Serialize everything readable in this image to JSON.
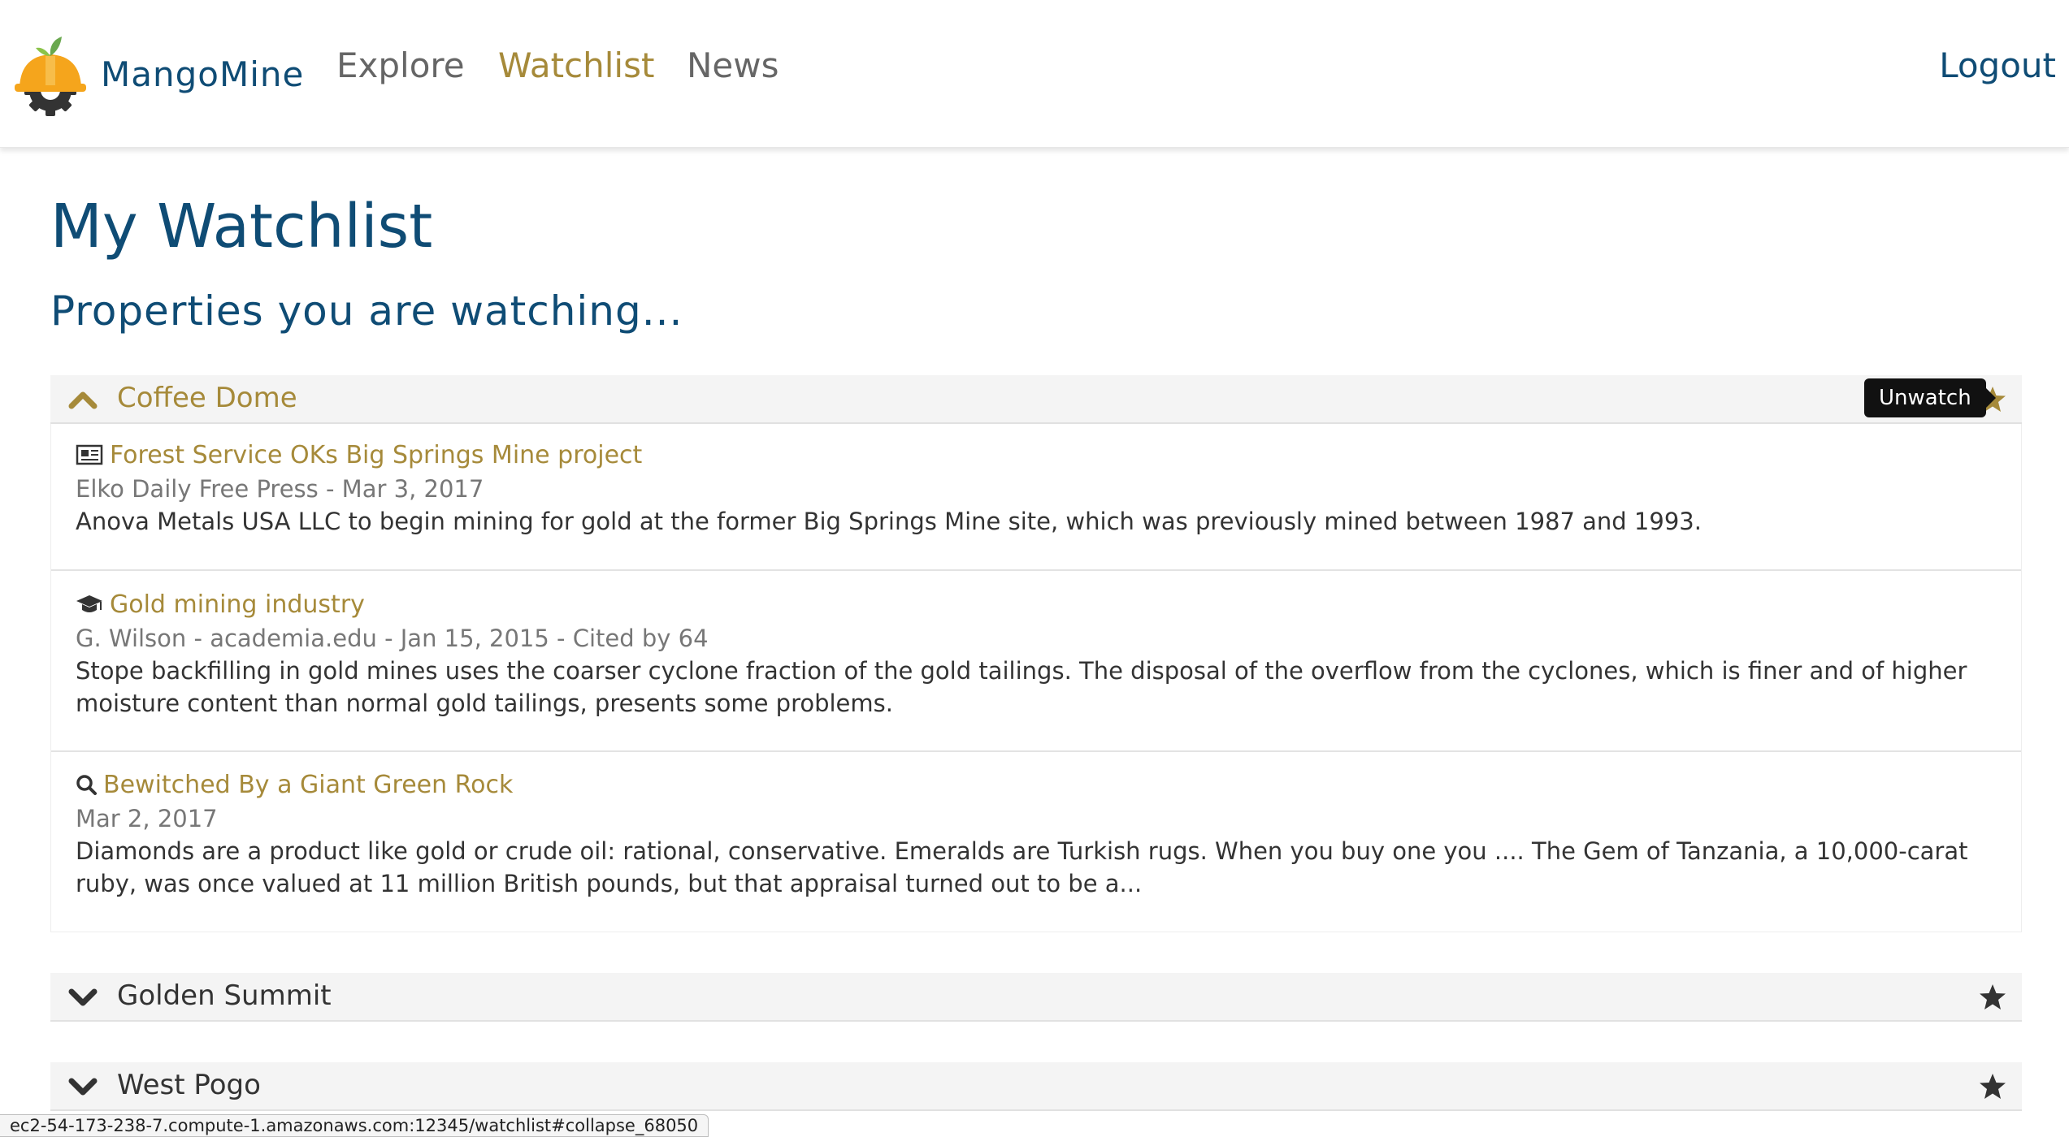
{
  "app": {
    "brand": "MangoMine"
  },
  "nav": {
    "explore": "Explore",
    "watchlist": "Watchlist",
    "news": "News",
    "logout": "Logout"
  },
  "colors": {
    "brand_blue": "#0f4c75",
    "gold": "#a68a3a",
    "panel_bg": "#f4f4f4"
  },
  "page": {
    "title": "My Watchlist",
    "subtitle": "Properties you are watching..."
  },
  "panels": [
    {
      "title": "Coffee Dome",
      "expanded": true,
      "tooltip": "Unwatch",
      "items": [
        {
          "icon": "newspaper-icon",
          "title": "Forest Service OKs Big Springs Mine project",
          "meta": "Elko Daily Free Press - Mar 3, 2017",
          "text": "Anova Metals USA LLC to begin mining for gold at the former Big Springs Mine site, which was previously mined between 1987 and 1993."
        },
        {
          "icon": "graduation-cap-icon",
          "title": "Gold mining industry",
          "meta": "G. Wilson - academia.edu - Jan 15, 2015 - Cited by 64",
          "text": "Stope backfilling in gold mines uses the coarser cyclone fraction of the gold tailings. The disposal of the overflow from the cyclones, which is finer and of higher moisture content than normal gold tailings, presents some problems."
        },
        {
          "icon": "search-icon",
          "title": "Bewitched By a Giant Green Rock",
          "meta": "Mar 2, 2017",
          "text": "Diamonds are a product like gold or crude oil: rational, conservative. Emeralds are Turkish rugs. When you buy one you .... The Gem of Tanzania, a 10,000-carat ruby, was once valued at 11 million British pounds, but that appraisal turned out to be a..."
        }
      ]
    },
    {
      "title": "Golden Summit",
      "expanded": false
    },
    {
      "title": "West Pogo",
      "expanded": false
    }
  ],
  "statusbar": {
    "url": "ec2-54-173-238-7.compute-1.amazonaws.com:12345/watchlist#collapse_68050"
  }
}
